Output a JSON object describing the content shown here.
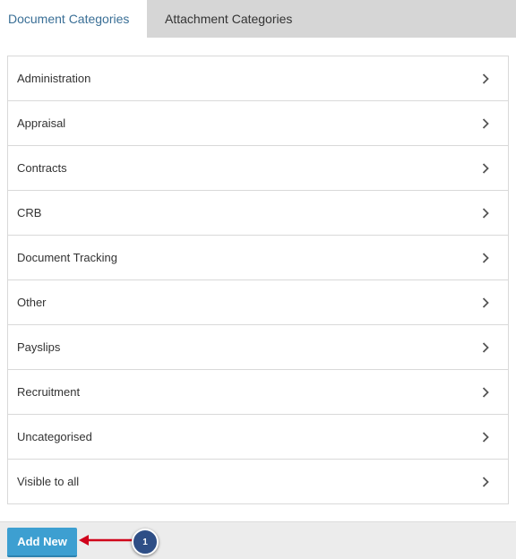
{
  "tabs": [
    {
      "label": "Document Categories",
      "active": true
    },
    {
      "label": "Attachment Categories",
      "active": false
    }
  ],
  "categories": [
    {
      "label": "Administration",
      "icon": "chevron-right-icon"
    },
    {
      "label": "Appraisal",
      "icon": "chevron-right-icon"
    },
    {
      "label": "Contracts",
      "icon": "chevron-right-icon"
    },
    {
      "label": "CRB",
      "icon": "chevron-right-icon"
    },
    {
      "label": "Document Tracking",
      "icon": "chevron-right-icon"
    },
    {
      "label": "Other",
      "icon": "chevron-right-icon"
    },
    {
      "label": "Payslips",
      "icon": "chevron-right-icon"
    },
    {
      "label": "Recruitment",
      "icon": "chevron-right-icon"
    },
    {
      "label": "Uncategorised",
      "icon": "chevron-right-icon"
    },
    {
      "label": "Visible to all",
      "icon": "chevron-right-icon"
    }
  ],
  "footer": {
    "add_new_label": "Add New"
  },
  "annotation": {
    "step_number": "1",
    "arrow_color": "#d0021b",
    "badge_color": "#2e4e86"
  },
  "colors": {
    "active_tab_text": "#3a6f96",
    "button_bg": "#3d9fd1"
  }
}
